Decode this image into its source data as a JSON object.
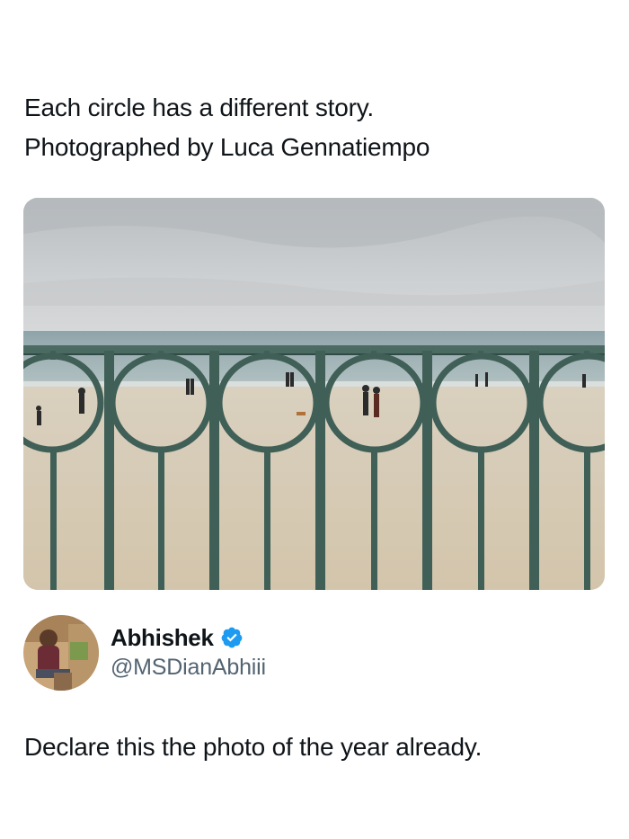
{
  "post": {
    "caption_line1": "Each circle has a different story.",
    "caption_line2": "Photographed by Luca Gennatiempo"
  },
  "photo": {
    "description_icon": "beach-railing-photo",
    "colors": {
      "sky": "#c9ccce",
      "sea": "#9fb3b8",
      "sand": "#d8ccb6",
      "railing": "#3f5f57"
    }
  },
  "author": {
    "display_name": "Abhishek",
    "handle": "@MSDianAbhiii",
    "verified_icon": "verified-badge-icon",
    "verified_color": "#1d9bf0"
  },
  "tweet": {
    "text": "Declare this the photo of the year already."
  }
}
